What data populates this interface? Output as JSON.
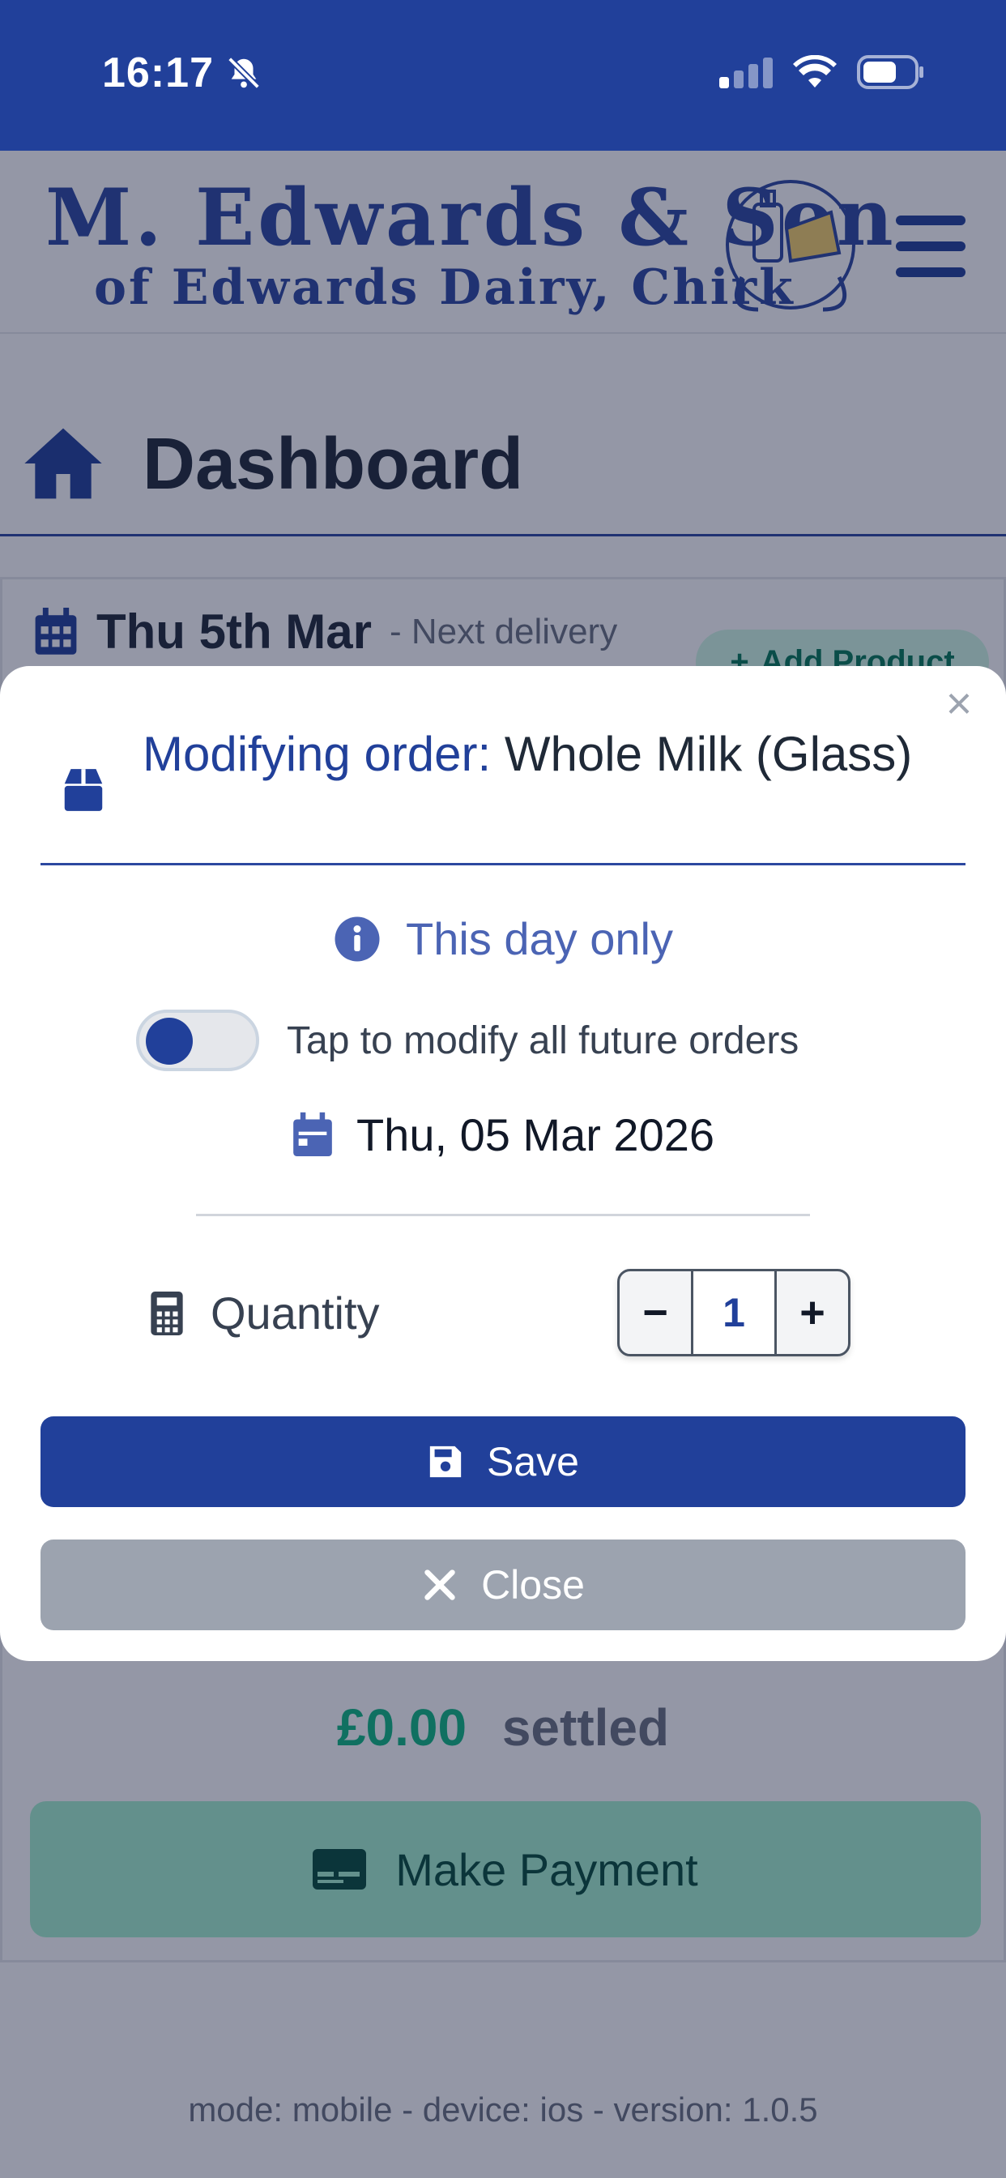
{
  "status_bar": {
    "time": "16:17",
    "mute_icon": "bell-slash-icon",
    "signal_icon": "cellular-signal-icon",
    "wifi_icon": "wifi-icon",
    "battery_icon": "battery-icon"
  },
  "header": {
    "logo_line1": "M. Edwards & Son",
    "logo_line2": "of Edwards Dairy, Chirk",
    "logo_emblem": "dairy-emblem-icon",
    "menu_icon": "hamburger-menu-icon"
  },
  "page": {
    "title": "Dashboard",
    "title_icon": "home-icon"
  },
  "delivery": {
    "date": "Thu 5th Mar",
    "subtitle": "- Next delivery",
    "add_product_label": "Add Product",
    "settled_amount": "£0.00",
    "settled_label": "settled",
    "make_payment_label": "Make Payment"
  },
  "footer": {
    "meta": "mode: mobile  -  device: ios  -  version: 1.0.5"
  },
  "modal": {
    "title_prefix": "Modifying order:",
    "title_product": "Whole Milk (Glass)",
    "scope_label": "This day only",
    "toggle_label": "Tap to modify all future orders",
    "toggle_on": false,
    "date": "Thu, 05 Mar 2026",
    "quantity_label": "Quantity",
    "quantity_value": "1",
    "decrement_label": "−",
    "increment_label": "+",
    "save_label": "Save",
    "close_label": "Close",
    "close_x": "×"
  },
  "colors": {
    "primary": "#21409a",
    "success": "#10b981",
    "muted": "#9ca3af"
  }
}
